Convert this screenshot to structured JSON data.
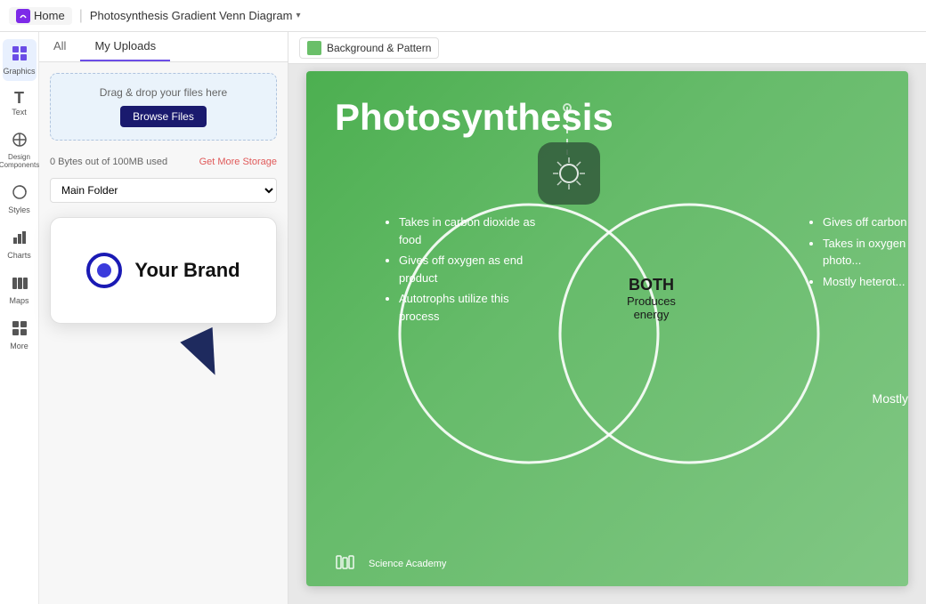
{
  "topbar": {
    "home_label": "Home",
    "title": "Photosynthesis Gradient Venn Diagram",
    "chevron": "▾"
  },
  "sidebar": {
    "items": [
      {
        "id": "graphics",
        "label": "Graphics",
        "icon": "⊞"
      },
      {
        "id": "text",
        "label": "Text",
        "icon": "T"
      },
      {
        "id": "design",
        "label": "Design Components",
        "icon": "⊡"
      },
      {
        "id": "styles",
        "label": "Styles",
        "icon": "◑"
      },
      {
        "id": "charts",
        "label": "Charts",
        "icon": "⊟"
      },
      {
        "id": "maps",
        "label": "Maps",
        "icon": "⊞"
      },
      {
        "id": "more",
        "label": "More",
        "icon": "⋯"
      }
    ]
  },
  "panel": {
    "tabs": [
      "All",
      "My Uploads"
    ],
    "active_tab": "My Uploads",
    "upload": {
      "drag_text": "Drag & drop your files here",
      "browse_label": "Browse Files"
    },
    "storage": {
      "used": "0 Bytes out of 100MB used",
      "cta": "Get More Storage"
    },
    "folder": {
      "label": "Main Folder",
      "options": [
        "Main Folder"
      ]
    }
  },
  "brand_card": {
    "brand_name": "Your Brand"
  },
  "canvas_topbar": {
    "bg_pattern_label": "Background & Pattern"
  },
  "slide": {
    "title": "Photosynthesis",
    "left_circle": {
      "items": [
        "Takes in carbon dioxide as food",
        "Gives off oxygen as end product",
        "Autotrophs utilize this process"
      ]
    },
    "center": {
      "title": "BOTH",
      "subtitle": "Produces energy"
    },
    "right_circle": {
      "items": [
        "Gives off carbon dioxide",
        "Takes in oxygen by photo...",
        "Mostly heterot..."
      ]
    },
    "footer": {
      "lab_name": "Science Academy"
    }
  },
  "detected": {
    "mostly_text": "Mostly"
  }
}
